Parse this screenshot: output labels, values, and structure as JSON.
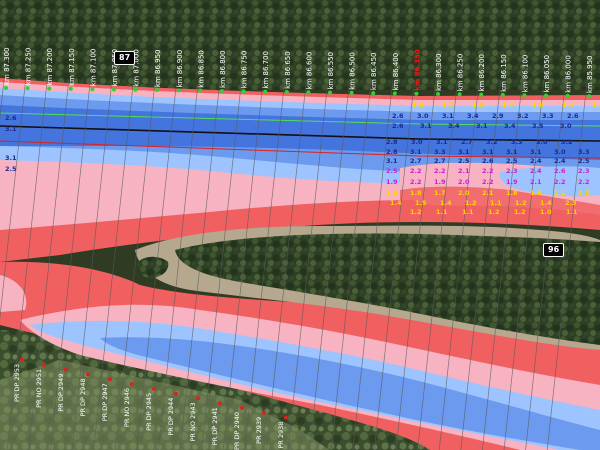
{
  "colors": {
    "forest_dark": "#27361f",
    "forest_mid": "#3c5130",
    "shallow_red": "#f06060",
    "pink": "#f7b3c2",
    "light_blue": "#9ec4ff",
    "blue": "#6b9aee",
    "deep_blue": "#4474de",
    "sandbar": "#b5a88f",
    "label_yellow": "#ffd400",
    "label_magenta": "#d21ad8",
    "label_navy": "#1a2b8a",
    "marker_green": "#2ed32e",
    "marker_red": "#e02020",
    "nav_line_green": "#4fe24f",
    "nav_line_red": "#e0201a"
  },
  "badges": {
    "left": "87",
    "right": "96"
  },
  "km_labels": [
    "km 87.300",
    "km 87.250",
    "km 87.200",
    "km 87.150",
    "km 87.100",
    "km 87.050",
    "km 87.000",
    "km 86.950",
    "km 86.900",
    "km 86.850",
    "km 86.800",
    "km 86.750",
    "km 86.700",
    "km 86.650",
    "km 86.600",
    "km 86.550",
    "km 86.500",
    "km 86.450",
    "km 86.400",
    "km 86.350",
    "km 86.300",
    "km 86.250",
    "km 86.200",
    "km 86.150",
    "km 86.100",
    "km 86.050",
    "km 86.000",
    "km 85.950"
  ],
  "km_highlight": "km 86.350",
  "pr_labels": [
    "PR DP 2953",
    "PR NO 2951",
    "PR DP 2949",
    "PR DP 2948",
    "PR DP 2947",
    "PR NO 2946",
    "PR DP 2945",
    "PR DP 2944",
    "PR NO 2943",
    "PR DP 2941",
    "PR DP 2940",
    "PR 2939",
    "PR 2938"
  ],
  "depth_rows": {
    "top_edge": [
      "1.6",
      "1.7",
      "1.3",
      "1.4",
      "1.5",
      "1.4",
      "1.6"
    ],
    "row1": [
      "2.6",
      "3.0",
      "3.1",
      "3.4",
      "2.9",
      "3.2",
      "3.3",
      "2.6"
    ],
    "row2": [
      "2.6",
      "3.1",
      "3.4",
      "3.1",
      "3.4",
      "3.5",
      "3.0"
    ],
    "row3": [
      "2.8",
      "3.0",
      "3.1",
      "2.7",
      "3.2",
      "3.3",
      "3.0",
      "3.2"
    ],
    "row4": [
      "2.8",
      "3.1",
      "3.3",
      "3.1",
      "3.1",
      "3.1",
      "3.1",
      "3.0",
      "3.3"
    ],
    "row5": [
      "3.1",
      "2.7",
      "2.7",
      "2.5",
      "2.6",
      "2.5",
      "2.4",
      "2.4",
      "2.5"
    ],
    "row6": [
      "2.5",
      "2.2",
      "2.2",
      "2.1",
      "2.2",
      "2.3",
      "2.4",
      "2.6",
      "2.3"
    ],
    "row7": [
      "1.9",
      "2.2",
      "1.9",
      "2.0",
      "2.2",
      "1.9",
      "2.1",
      "2.2",
      "2.2"
    ],
    "row8": [
      "1.6",
      "1.8",
      "1.7",
      "2.0",
      "2.1",
      "1.8",
      "1.6",
      "2.1",
      "2.5"
    ],
    "row9": [
      "1.4",
      "1.5",
      "1.4",
      "1.2",
      "1.1",
      "1.2",
      "1.4",
      "2.3"
    ],
    "row10": [
      "1.2",
      "1.1",
      "1.1",
      "1.2",
      "1.2",
      "1.0",
      "1.1"
    ]
  }
}
